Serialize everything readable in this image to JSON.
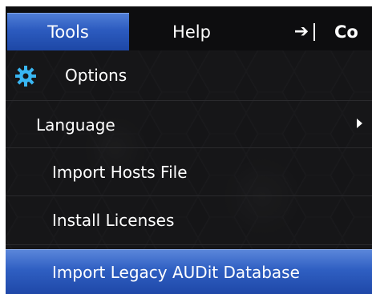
{
  "menubar": {
    "tools_label": "Tools",
    "help_label": "Help",
    "arrow_symbol": "➔",
    "cut_label": "Co"
  },
  "menu": {
    "items": [
      {
        "label": "Options",
        "icon": "gear-icon"
      },
      {
        "label": "Language",
        "icon": "chevron-right-icon"
      },
      {
        "label": "Import Hosts File"
      },
      {
        "label": "Install Licenses"
      },
      {
        "label": "Import Legacy AUDit Database"
      }
    ]
  },
  "colors": {
    "highlight": "#2c5bbf",
    "background": "#151517",
    "gear": "#39b6f2"
  }
}
